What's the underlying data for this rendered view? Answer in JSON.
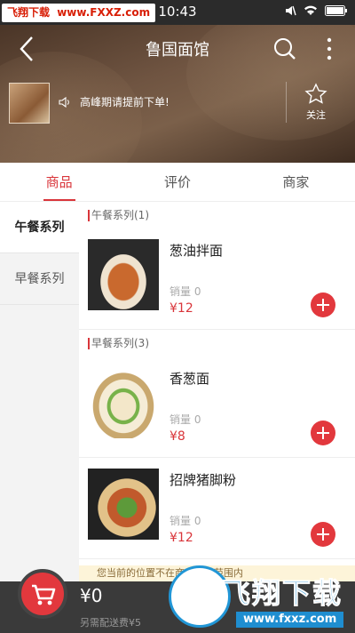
{
  "status_bar": {
    "watermark_site": "飞翔下载",
    "watermark_url": "www.FXXZ.com",
    "time": "10:43"
  },
  "header": {
    "title": "鲁国面馆",
    "notice": "高峰期请提前下单!",
    "follow_label": "关注",
    "icons": [
      "back-arrow-icon",
      "search-icon",
      "more-vertical-icon",
      "speaker-icon",
      "star-icon"
    ]
  },
  "tabs": [
    {
      "label": "商品",
      "active": true
    },
    {
      "label": "评价",
      "active": false
    },
    {
      "label": "商家",
      "active": false
    }
  ],
  "sidebar": {
    "categories": [
      {
        "label": "午餐系列",
        "active": true
      },
      {
        "label": "早餐系列",
        "active": false
      }
    ]
  },
  "menu": {
    "sections": [
      {
        "header": "午餐系列(1)",
        "items": [
          {
            "name": "葱油拌面",
            "sales": "销量 0",
            "price": "¥12"
          }
        ]
      },
      {
        "header": "早餐系列(3)",
        "items": [
          {
            "name": "香葱面",
            "sales": "销量 0",
            "price": "¥8"
          },
          {
            "name": "招牌猪脚粉",
            "sales": "销量 0",
            "price": "¥12"
          }
        ]
      }
    ]
  },
  "hint": "您当前的位置不在商家配送范围内",
  "cart": {
    "total": "¥0",
    "delivery_fee": "另需配送费¥5"
  },
  "watermark_bottom": {
    "brand": "飞翔下载",
    "url": "www.fxxz.com"
  },
  "colors": {
    "accent": "#d9353a",
    "cart_bar": "#3a3a3a"
  }
}
